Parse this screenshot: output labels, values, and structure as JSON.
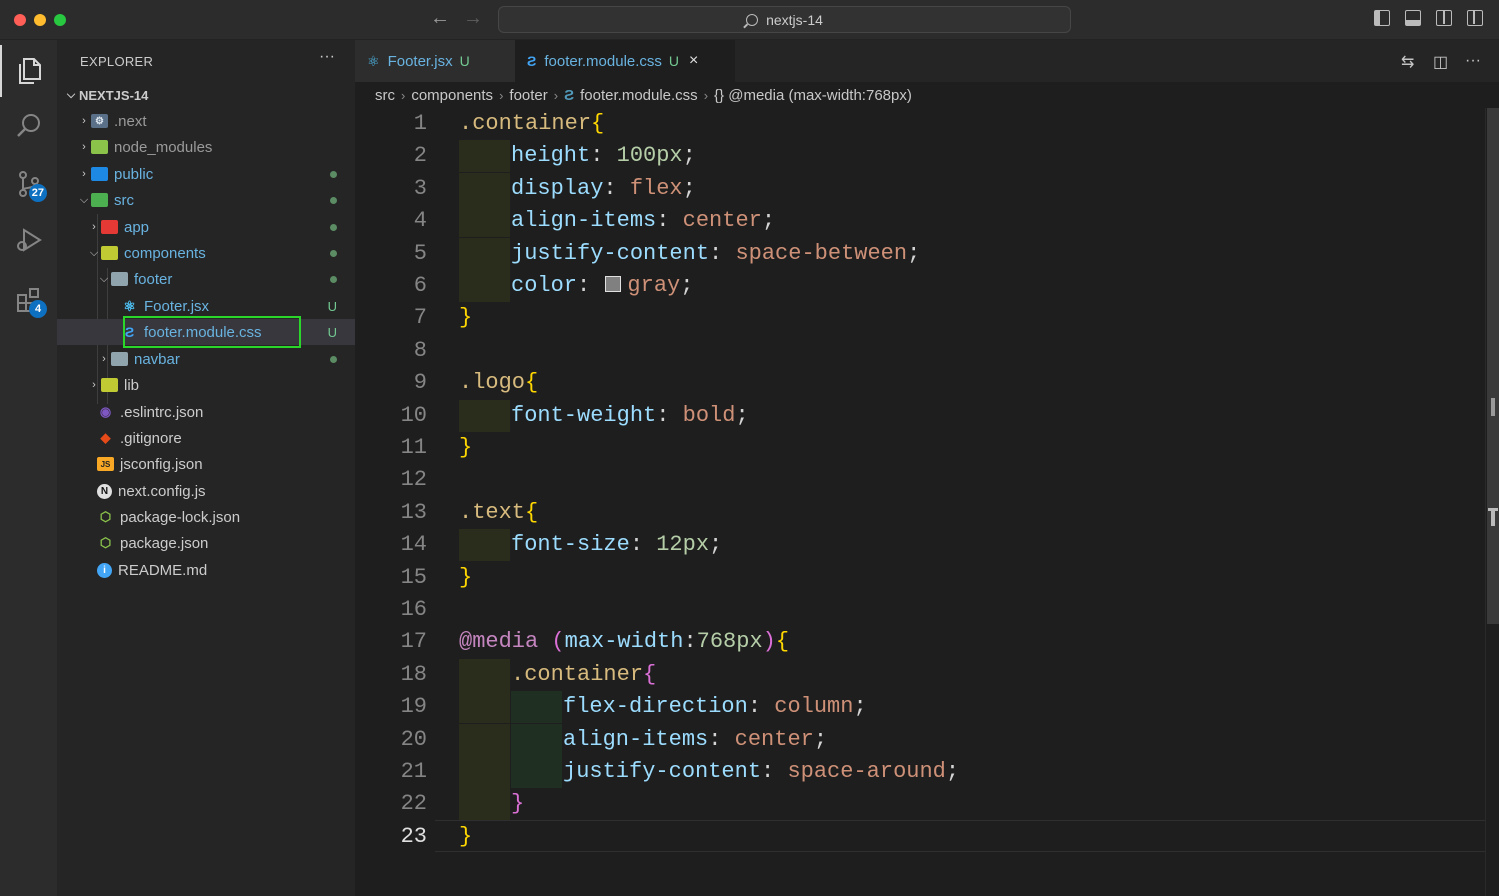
{
  "window": {
    "search_text": "nextjs-14"
  },
  "activity_bar": {
    "scm_badge": "27",
    "extensions_badge": "4"
  },
  "sidebar": {
    "title": "EXPLORER",
    "more": "···",
    "project": "NEXTJS-14",
    "tree": [
      {
        "label": ".next",
        "icon": "next-folder-icon",
        "color": "#cccccc"
      },
      {
        "label": "node_modules",
        "icon": "node-folder-icon",
        "color": "#cccccc"
      },
      {
        "label": "public",
        "icon": "public-folder-icon",
        "color": "#69b3e0"
      },
      {
        "label": "src",
        "icon": "src-folder-icon",
        "color": "#69b3e0"
      },
      {
        "label": "app",
        "icon": "app-folder-icon",
        "color": "#69b3e0"
      },
      {
        "label": "components",
        "icon": "components-folder-icon",
        "color": "#69b3e0"
      },
      {
        "label": "footer",
        "icon": "folder-icon",
        "color": "#69b3e0"
      },
      {
        "label": "Footer.jsx",
        "icon": "react-icon",
        "color": "#69b3e0",
        "status": "U"
      },
      {
        "label": "footer.module.css",
        "icon": "css-icon",
        "color": "#69b3e0",
        "status": "U"
      },
      {
        "label": "navbar",
        "icon": "folder-icon",
        "color": "#69b3e0"
      },
      {
        "label": "lib",
        "icon": "lib-folder-icon",
        "color": "#cccccc"
      },
      {
        "label": ".eslintrc.json",
        "icon": "eslint-icon",
        "color": "#cccccc"
      },
      {
        "label": ".gitignore",
        "icon": "git-icon",
        "color": "#cccccc"
      },
      {
        "label": "jsconfig.json",
        "icon": "jsconfig-icon",
        "color": "#cccccc"
      },
      {
        "label": "next.config.js",
        "icon": "next-icon",
        "color": "#cccccc"
      },
      {
        "label": "package-lock.json",
        "icon": "node-icon",
        "color": "#cccccc"
      },
      {
        "label": "package.json",
        "icon": "node-icon",
        "color": "#cccccc"
      },
      {
        "label": "README.md",
        "icon": "info-icon",
        "color": "#cccccc"
      }
    ]
  },
  "tabs": [
    {
      "label": "Footer.jsx",
      "status": "U"
    },
    {
      "label": "footer.module.css",
      "status": "U",
      "close": "×"
    }
  ],
  "breadcrumb": [
    "src",
    "components",
    "footer",
    "footer.module.css",
    "{} @media (max-width:768px)"
  ],
  "editor": {
    "line_numbers": [
      "1",
      "2",
      "3",
      "4",
      "5",
      "6",
      "7",
      "8",
      "9",
      "10",
      "11",
      "12",
      "13",
      "14",
      "15",
      "16",
      "17",
      "18",
      "19",
      "20",
      "21",
      "22",
      "23"
    ],
    "code_lines": [
      ".container{",
      "    height: 100px;",
      "    display: flex;",
      "    align-items: center;",
      "    justify-content: space-between;",
      "    color: gray;",
      "}",
      "",
      ".logo{",
      "    font-weight: bold;",
      "}",
      "",
      ".text{",
      "    font-size: 12px;",
      "}",
      "",
      "@media (max-width:768px){",
      "    .container{",
      "        flex-direction: column;",
      "        align-items: center;",
      "        justify-content: space-around;",
      "    }",
      "}"
    ]
  }
}
